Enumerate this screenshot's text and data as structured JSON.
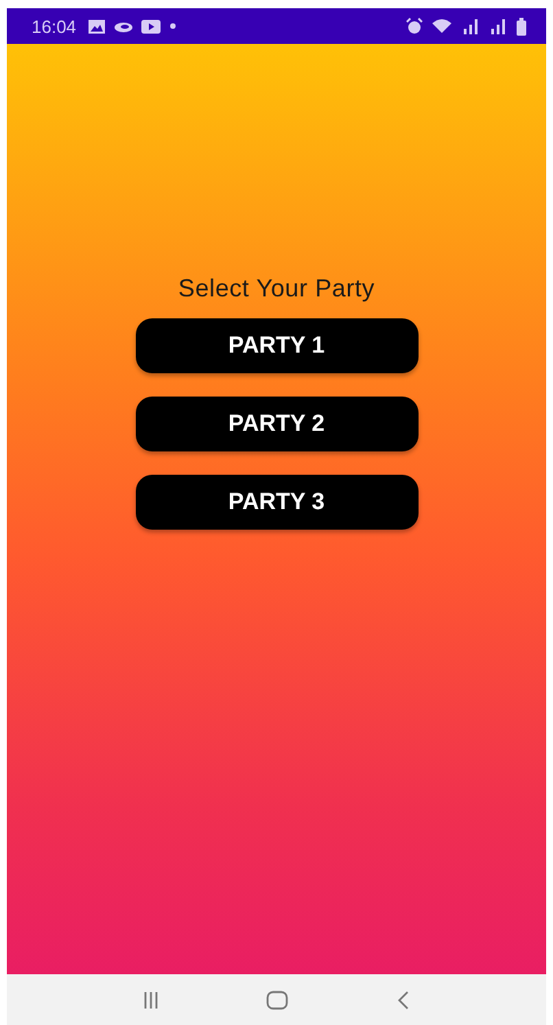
{
  "status_bar": {
    "time": "16:04"
  },
  "heading": "Select Your Party",
  "buttons": [
    {
      "label": "PARTY 1"
    },
    {
      "label": "PARTY 2"
    },
    {
      "label": "PARTY 3"
    }
  ]
}
